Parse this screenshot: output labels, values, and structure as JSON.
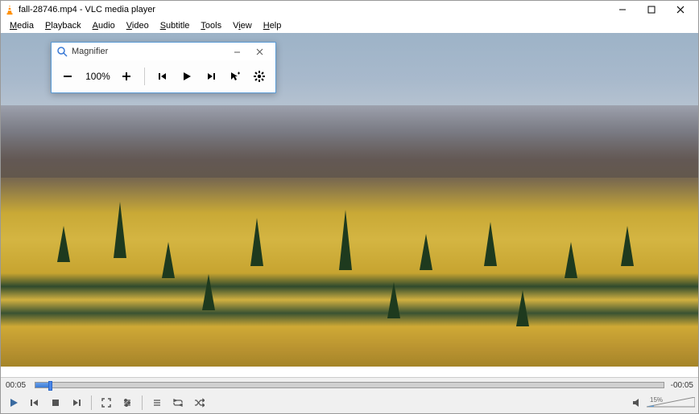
{
  "titlebar": {
    "title": "fall-28746.mp4 - VLC media player"
  },
  "menu": {
    "items": [
      {
        "u": "M",
        "rest": "edia"
      },
      {
        "u": "P",
        "rest": "layback"
      },
      {
        "u": "A",
        "rest": "udio"
      },
      {
        "u": "V",
        "rest": "ideo"
      },
      {
        "u": "S",
        "rest": "ubtitle"
      },
      {
        "u": "T",
        "rest": "ools"
      },
      {
        "u": "V",
        "rest": "iew",
        "full": "View",
        "u2": "i"
      },
      {
        "u": "H",
        "rest": "elp"
      }
    ]
  },
  "magnifier": {
    "title": "Magnifier",
    "zoom": "100%"
  },
  "playback": {
    "elapsed": "00:05",
    "remaining": "-00:05"
  },
  "volume": {
    "label": "15%"
  }
}
